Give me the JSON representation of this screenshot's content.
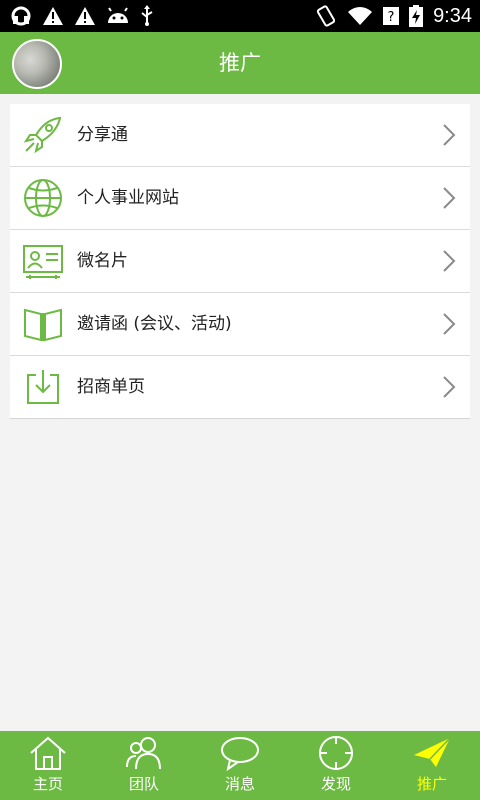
{
  "status_bar": {
    "time": "9:34"
  },
  "header": {
    "title": "推广"
  },
  "menu": {
    "items": [
      {
        "label": "分享通",
        "icon": "rocket-icon"
      },
      {
        "label": "个人事业网站",
        "icon": "globe-icon"
      },
      {
        "label": "微名片",
        "icon": "business-card-icon"
      },
      {
        "label": "邀请函 (会议、活动)",
        "icon": "open-book-icon"
      },
      {
        "label": "招商单页",
        "icon": "download-box-icon"
      }
    ]
  },
  "tabbar": {
    "items": [
      {
        "label": "主页",
        "icon": "home-icon"
      },
      {
        "label": "团队",
        "icon": "team-icon"
      },
      {
        "label": "消息",
        "icon": "chat-bubble-icon"
      },
      {
        "label": "发现",
        "icon": "crosshair-icon"
      },
      {
        "label": "推广",
        "icon": "paper-plane-icon",
        "active": true
      }
    ]
  },
  "colors": {
    "primary_green": "#6cba43",
    "active_tab_text": "#ffff00",
    "icon_green": "#6cba43"
  }
}
